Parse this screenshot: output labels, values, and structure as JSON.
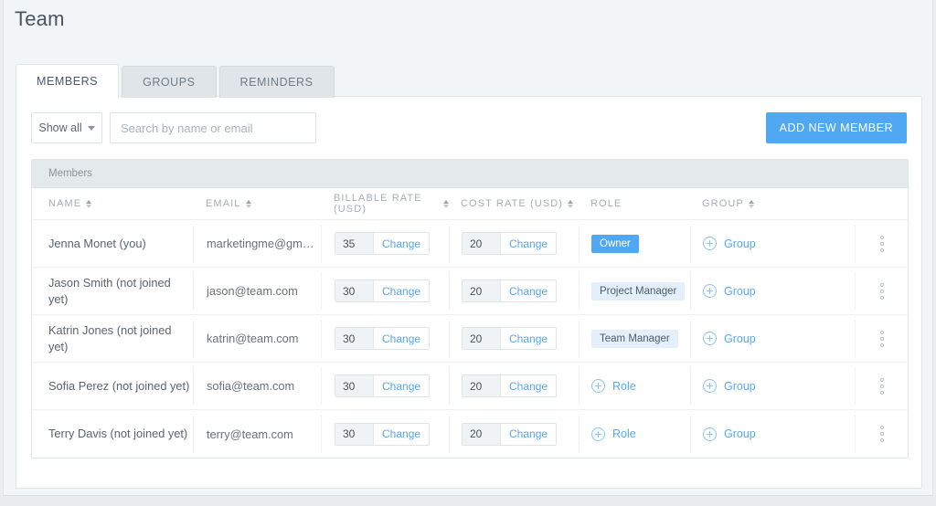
{
  "page": {
    "title": "Team"
  },
  "tabs": [
    {
      "label": "MEMBERS",
      "active": true
    },
    {
      "label": "GROUPS",
      "active": false
    },
    {
      "label": "REMINDERS",
      "active": false
    }
  ],
  "toolbar": {
    "filter_label": "Show all",
    "search_placeholder": "Search by name or email",
    "search_value": "",
    "add_button": "ADD NEW MEMBER"
  },
  "table": {
    "band_label": "Members",
    "columns": [
      {
        "label": "NAME",
        "sortable": true
      },
      {
        "label": "EMAIL",
        "sortable": true
      },
      {
        "label": "BILLABLE RATE (USD)",
        "sortable": true
      },
      {
        "label": "COST RATE (USD)",
        "sortable": true
      },
      {
        "label": "ROLE",
        "sortable": false
      },
      {
        "label": "GROUP",
        "sortable": true
      }
    ],
    "change_label": "Change",
    "add_role_label": "Role",
    "add_group_label": "Group",
    "rows": [
      {
        "name": "Jenna Monet (you)",
        "email": "marketingme@gm…",
        "billable_rate": "35",
        "cost_rate": "20",
        "role": "Owner",
        "role_style": "owner",
        "group": ""
      },
      {
        "name": "Jason Smith (not joined yet)",
        "email": "jason@team.com",
        "billable_rate": "30",
        "cost_rate": "20",
        "role": "Project Manager",
        "role_style": "soft",
        "group": ""
      },
      {
        "name": "Katrin Jones (not joined yet)",
        "email": "katrin@team.com",
        "billable_rate": "30",
        "cost_rate": "20",
        "role": "Team Manager",
        "role_style": "soft",
        "group": ""
      },
      {
        "name": "Sofia Perez (not joined yet)",
        "email": "sofia@team.com",
        "billable_rate": "30",
        "cost_rate": "20",
        "role": "",
        "role_style": "add",
        "group": ""
      },
      {
        "name": "Terry Davis (not joined yet)",
        "email": "terry@team.com",
        "billable_rate": "30",
        "cost_rate": "20",
        "role": "",
        "role_style": "add",
        "group": ""
      }
    ]
  },
  "colors": {
    "accent": "#51a8f2",
    "link": "#55a6ef",
    "badge_soft_bg": "#e3f0fb",
    "page_bg": "#f2f5f7",
    "band_bg": "#e4e9ec"
  }
}
